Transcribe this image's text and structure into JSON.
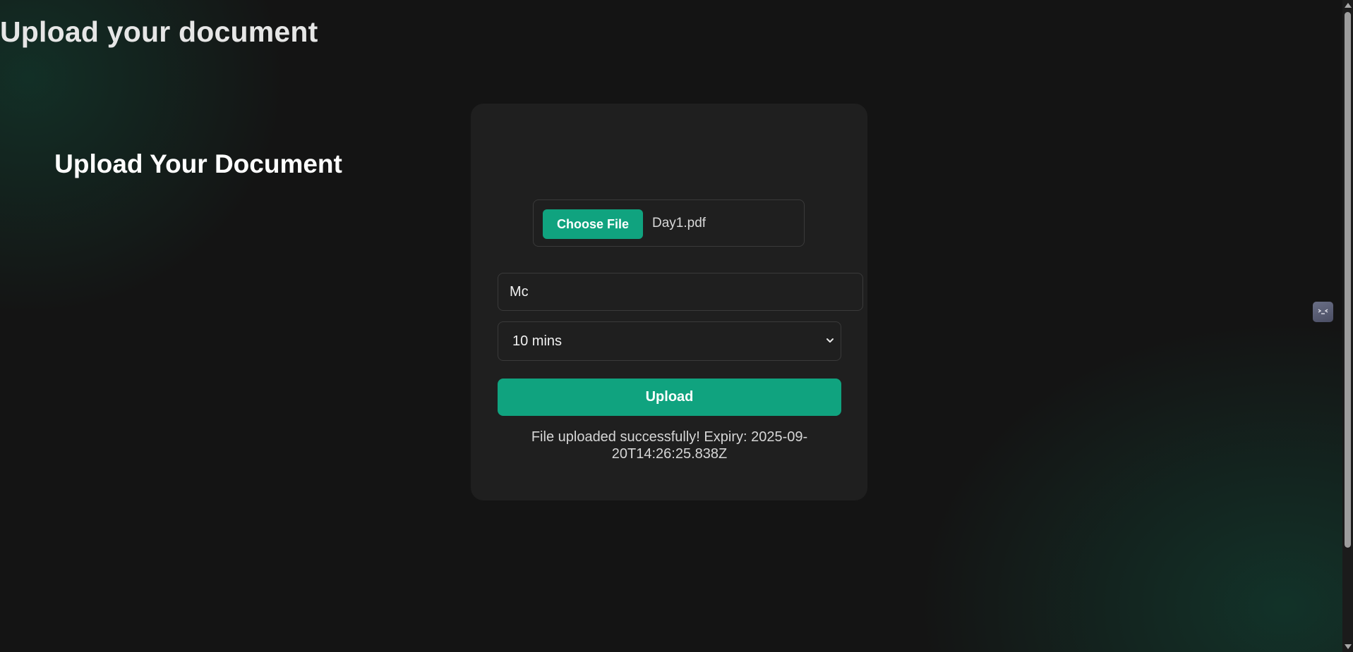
{
  "page": {
    "title": "Upload your document"
  },
  "card": {
    "title": "Upload Your Document",
    "file_input": {
      "button_label": "Choose File",
      "file_name": "Day1.pdf"
    },
    "name_input": {
      "value": "Mc"
    },
    "expiry_select": {
      "selected": "10 mins"
    },
    "upload_label": "Upload",
    "status_message": "File uploaded successfully! Expiry: 2025-09-20T14:26:25.838Z"
  },
  "colors": {
    "accent": "#10a37f",
    "background": "#141414",
    "card": "#1f1f1f"
  },
  "icons": {
    "select_arrow": "chevron-down-icon",
    "extension": "extension-icon"
  }
}
